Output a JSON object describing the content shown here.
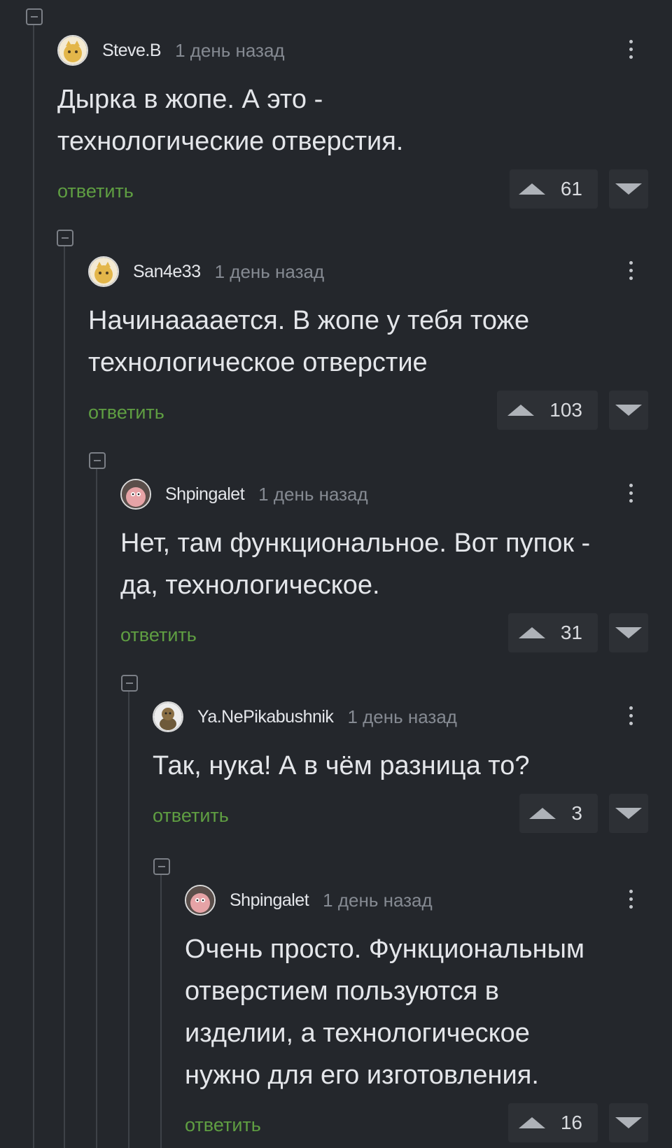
{
  "comments": [
    {
      "user": "Steve.B",
      "time": "1 день назад",
      "lines": [
        "Дырка в жопе. А это -",
        "технологические отверстия."
      ],
      "reply": "ответить",
      "rating": "61",
      "avatar": "cat-avatar"
    },
    {
      "user": "San4e33",
      "time": "1 день назад",
      "lines": [
        "Начинаааается. В жопе у тебя тоже",
        "технологическое отверстие"
      ],
      "reply": "ответить",
      "rating": "103",
      "avatar": "cat-avatar"
    },
    {
      "user": "Shpingalet",
      "time": "1 день назад",
      "lines": [
        "Нет, там функциональное. Вот пупок -",
        "да, технологическое."
      ],
      "reply": "ответить",
      "rating": "31",
      "avatar": "patrick-avatar"
    },
    {
      "user": "Ya.NePikabushnik",
      "time": "1 день назад",
      "lines": [
        "Так, нука! А в чём разница то?"
      ],
      "reply": "ответить",
      "rating": "3",
      "avatar": "statue-avatar"
    },
    {
      "user": "Shpingalet",
      "time": "1 день назад",
      "lines": [
        "Очень просто. Функциональным",
        "отверстием пользуются в",
        "изделии, а технологическое",
        "нужно для его изготовления."
      ],
      "reply": "ответить",
      "rating": "16",
      "avatar": "patrick-avatar"
    }
  ],
  "icons": {
    "collapse": "collapse-icon",
    "more": "more-icon",
    "upvote": "upvote-icon",
    "downvote": "downvote-icon"
  },
  "colors": {
    "background": "#24272c",
    "reply_link": "#5f9e42",
    "text": "#e4e6ea",
    "muted": "#858a92"
  }
}
